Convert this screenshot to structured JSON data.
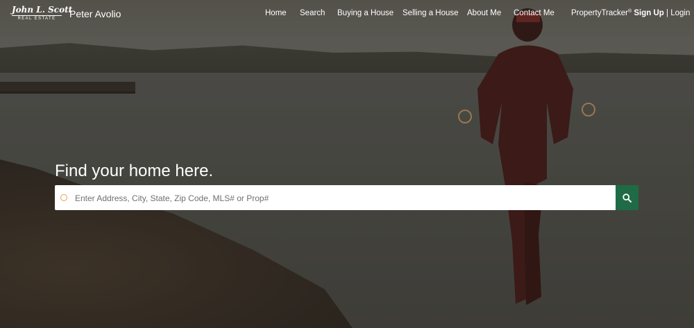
{
  "brand": {
    "logo_script": "John L. Scott",
    "logo_sub": "REAL ESTATE",
    "agent_name": "Peter Avolio"
  },
  "nav": {
    "home": "Home",
    "search": "Search",
    "buying": "Buying a House",
    "selling": "Selling a House",
    "about": "About Me",
    "contact": "Contact Me"
  },
  "account": {
    "property_tracker": "PropertyTracker",
    "registered_mark": "®",
    "sign_up": "Sign Up",
    "separator": "|",
    "login": "Login"
  },
  "hero": {
    "title": "Find your home here.",
    "search_placeholder": "Enter Address, City, State, Zip Code, MLS# or Prop#"
  },
  "colors": {
    "search_button": "#1f6b45",
    "pin_icon": "#e2a15e"
  },
  "icons": {
    "search_button": "search-icon",
    "input_marker": "location-pin-icon"
  }
}
